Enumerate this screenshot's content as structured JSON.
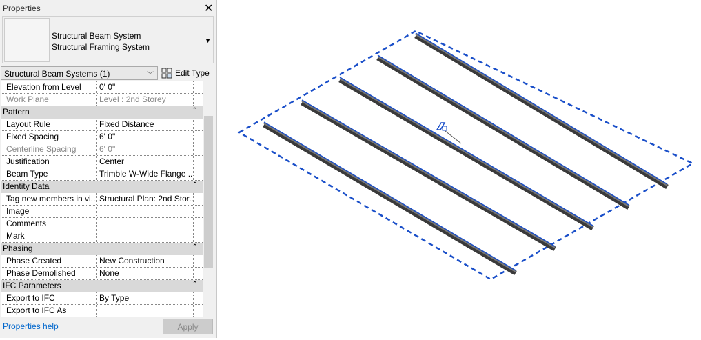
{
  "panel": {
    "title": "Properties",
    "type_name": "Structural Beam System",
    "type_family": "Structural Framing System",
    "filter": "Structural Beam Systems (1)",
    "edit_type": "Edit Type",
    "help": "Properties help",
    "apply": "Apply"
  },
  "rows": [
    {
      "kind": "row",
      "name": "Elevation from Level",
      "value": "0'  0\""
    },
    {
      "kind": "row",
      "name": "Work Plane",
      "value": "Level : 2nd Storey",
      "disabled": true
    },
    {
      "kind": "group",
      "name": "Pattern"
    },
    {
      "kind": "row",
      "name": "Layout Rule",
      "value": "Fixed Distance"
    },
    {
      "kind": "row",
      "name": "Fixed Spacing",
      "value": "6'  0\""
    },
    {
      "kind": "row",
      "name": "Centerline Spacing",
      "value": "6'  0\"",
      "disabled": true
    },
    {
      "kind": "row",
      "name": "Justification",
      "value": "Center"
    },
    {
      "kind": "row",
      "name": "Beam Type",
      "value": "Trimble W-Wide Flange ..."
    },
    {
      "kind": "group",
      "name": "Identity Data"
    },
    {
      "kind": "row",
      "name": "Tag new members in vi...",
      "value": "Structural Plan: 2nd Stor..."
    },
    {
      "kind": "row",
      "name": "Image",
      "value": ""
    },
    {
      "kind": "row",
      "name": "Comments",
      "value": ""
    },
    {
      "kind": "row",
      "name": "Mark",
      "value": ""
    },
    {
      "kind": "group",
      "name": "Phasing"
    },
    {
      "kind": "row",
      "name": "Phase Created",
      "value": "New Construction"
    },
    {
      "kind": "row",
      "name": "Phase Demolished",
      "value": "None"
    },
    {
      "kind": "group",
      "name": "IFC Parameters"
    },
    {
      "kind": "row",
      "name": "Export to IFC",
      "value": "By Type"
    },
    {
      "kind": "row",
      "name": "Export to IFC As",
      "value": ""
    }
  ],
  "colors": {
    "selection": "#1a4fc9",
    "beam": "#4a4a4a"
  }
}
